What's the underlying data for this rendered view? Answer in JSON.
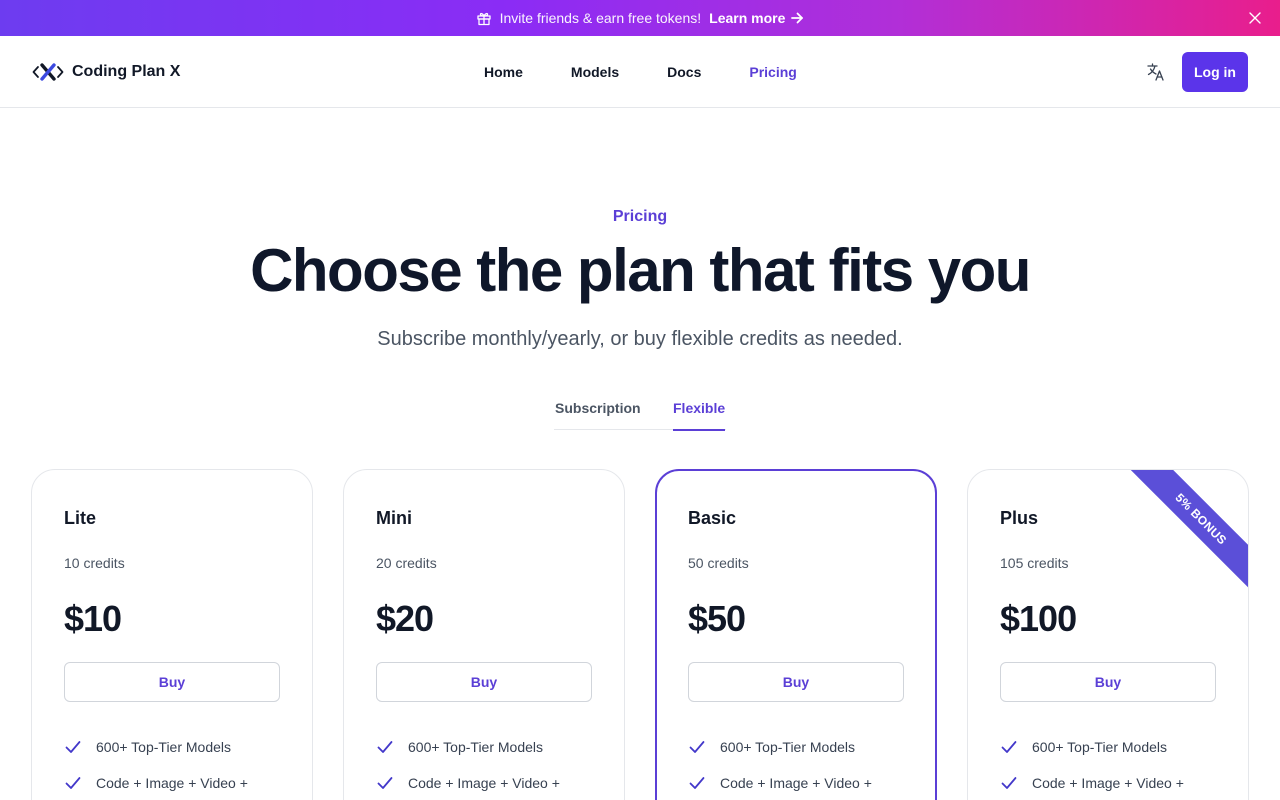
{
  "banner": {
    "message": "Invite friends & earn free tokens!",
    "link_label": "Learn more",
    "icon": "gift-icon"
  },
  "brand": {
    "name": "Coding Plan X",
    "accent": "#5b3fd6",
    "button_color": "#5b34ea"
  },
  "nav": {
    "items": [
      {
        "label": "Home",
        "active": false
      },
      {
        "label": "Models",
        "active": false
      },
      {
        "label": "Docs",
        "active": false
      },
      {
        "label": "Pricing",
        "active": true
      }
    ],
    "login_label": "Log in"
  },
  "hero": {
    "eyebrow": "Pricing",
    "title": "Choose the plan that fits you",
    "subtitle": "Subscribe monthly/yearly, or buy flexible credits as needed."
  },
  "tabs": [
    {
      "label": "Subscription",
      "selected": false
    },
    {
      "label": "Flexible",
      "selected": true
    }
  ],
  "plans": [
    {
      "name": "Lite",
      "credits": "10 credits",
      "price": "$10",
      "buy_label": "Buy",
      "featured": false,
      "features": [
        "600+ Top-Tier Models",
        "Code + Image + Video +"
      ]
    },
    {
      "name": "Mini",
      "credits": "20 credits",
      "price": "$20",
      "buy_label": "Buy",
      "featured": false,
      "features": [
        "600+ Top-Tier Models",
        "Code + Image + Video +"
      ]
    },
    {
      "name": "Basic",
      "credits": "50 credits",
      "price": "$50",
      "buy_label": "Buy",
      "featured": true,
      "features": [
        "600+ Top-Tier Models",
        "Code + Image + Video +"
      ]
    },
    {
      "name": "Plus",
      "credits": "105 credits",
      "price": "$100",
      "buy_label": "Buy",
      "featured": false,
      "ribbon": "5% BONUS",
      "features": [
        "600+ Top-Tier Models",
        "Code + Image + Video +"
      ]
    }
  ]
}
